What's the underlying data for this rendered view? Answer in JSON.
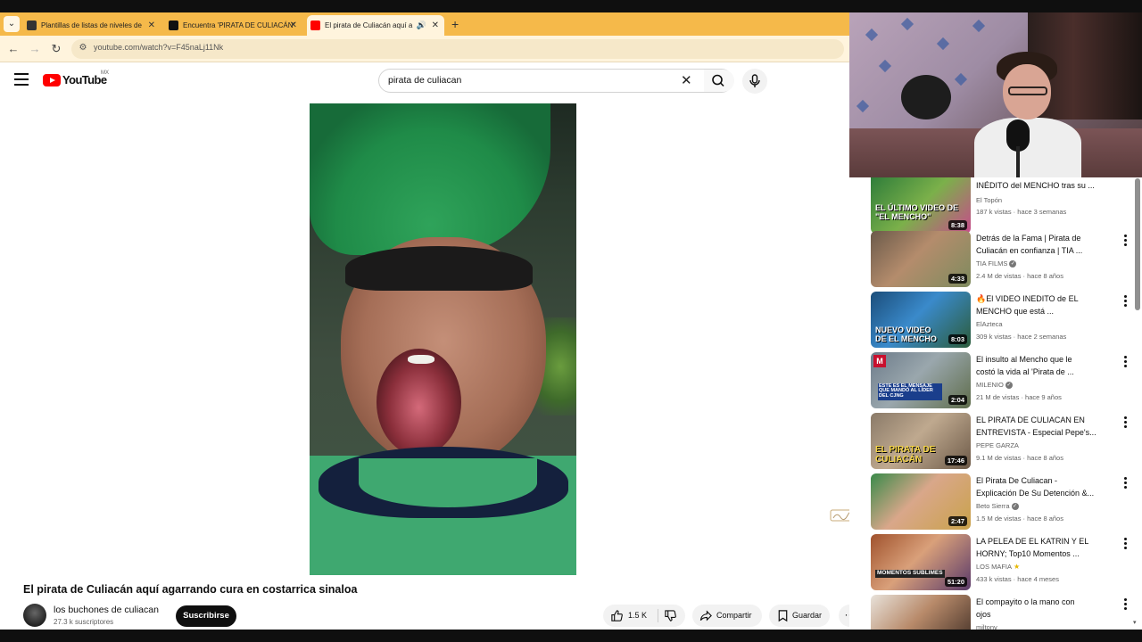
{
  "browser": {
    "tabs": [
      {
        "label": "Plantillas de listas de niveles de"
      },
      {
        "label": "Encuentra 'PIRATA DE CULIACÁN'"
      },
      {
        "label": "El pirata de Culiacán aquí a"
      }
    ],
    "url": "youtube.com/watch?v=F45naLj11Nk"
  },
  "youtube": {
    "logo_text": "YouTube",
    "region": "MX",
    "search_value": "pirata de culiacan"
  },
  "video": {
    "title": "El pirata de Culiacán aquí agarrando cura en costarrica sinaloa",
    "channel": "los buchones de culiacan",
    "subscribers": "27.3 k suscriptores",
    "subscribe_label": "Suscribirse",
    "likes": "1.5 K",
    "share_label": "Compartir",
    "save_label": "Guardar"
  },
  "recommendations": [
    {
      "title_line1": "INÉDITO del MENCHO tras su ...",
      "title_line2": "",
      "channel": "El Topón",
      "meta": "187 k vistas · hace 3 semanas",
      "duration": "8:38",
      "thumb_caption": "EL ÚLTIMO VIDEO DE \"EL MENCHO\"",
      "verified": false,
      "star": false
    },
    {
      "title_line1": "Detrás de la Fama | Pirata de",
      "title_line2": "Culiacán en confianza | TIA ...",
      "channel": "TIA FILMS",
      "meta": "2.4 M de vistas · hace 8 años",
      "duration": "4:33",
      "thumb_caption": "",
      "verified": true,
      "star": false
    },
    {
      "title_line1": "🔥El VIDEO INEDITO de EL",
      "title_line2": "MENCHO que está ...",
      "channel": "ElAzteca",
      "meta": "309 k vistas · hace 2 semanas",
      "duration": "8:03",
      "thumb_caption": "NUEVO VIDEO DE EL MENCHO",
      "verified": false,
      "star": false
    },
    {
      "title_line1": "El insulto al Mencho que le",
      "title_line2": "costó la vida al 'Pirata de ...",
      "channel": "MILENIO",
      "meta": "21 M de vistas · hace 9 años",
      "duration": "2:04",
      "thumb_caption": "ESTE ES EL MENSAJE QUE MANDÓ AL LÍDER DEL CJNG",
      "verified": true,
      "star": false
    },
    {
      "title_line1": "EL PIRATA DE CULIACAN EN",
      "title_line2": "ENTREVISTA - Especial Pepe's...",
      "channel": "PEPE GARZA",
      "meta": "9.1 M de vistas · hace 8 años",
      "duration": "17:46",
      "thumb_caption": "EL PIRATA DE CULIACÁN",
      "verified": false,
      "star": false
    },
    {
      "title_line1": "El Pirata De Culiacan -",
      "title_line2": "Explicación De Su Detención &...",
      "channel": "Beto Sierra",
      "meta": "1.5 M de vistas · hace 8 años",
      "duration": "2:47",
      "thumb_caption": "",
      "verified": true,
      "star": false
    },
    {
      "title_line1": "LA PELEA DE EL KATRIN Y EL",
      "title_line2": "HORNY; Top10 Momentos ...",
      "channel": "LOS MAFIA",
      "meta": "433 k vistas · hace 4 meses",
      "duration": "51:20",
      "thumb_caption": "MOMENTOS SUBLIMES",
      "verified": false,
      "star": true
    },
    {
      "title_line1": "El compayito o la mano con",
      "title_line2": "ojos",
      "channel": "miltonv",
      "meta": "",
      "duration": "",
      "thumb_caption": "",
      "verified": false,
      "star": false
    }
  ],
  "colors": {
    "tabstrip": "#f5b94a",
    "youtube_red": "#ff0000",
    "subscribe_bg": "#0f0f0f"
  }
}
